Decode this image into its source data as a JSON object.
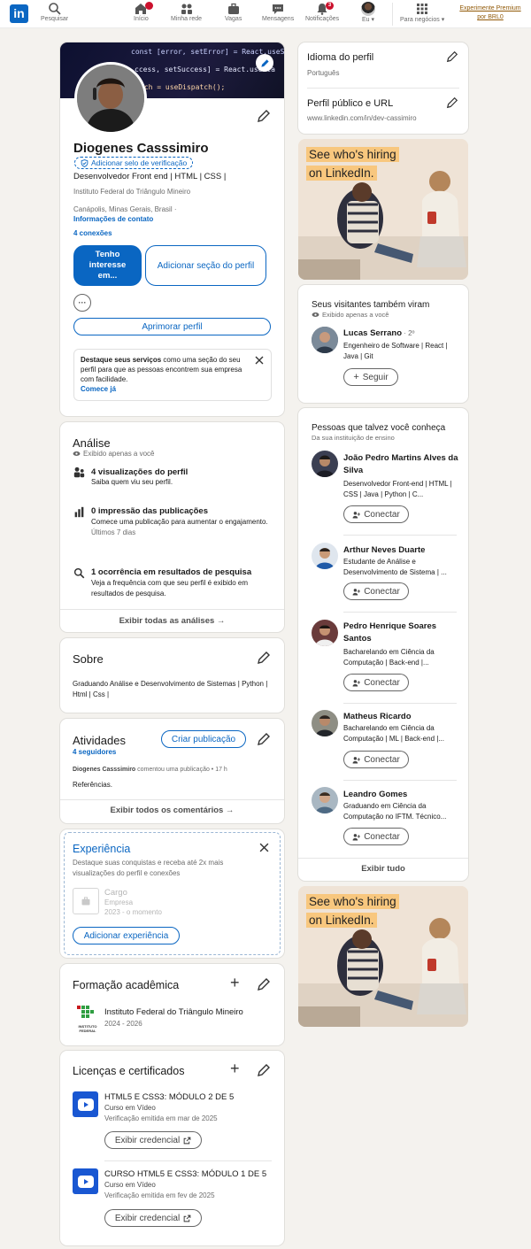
{
  "nav": {
    "search_label": "Pesquisar",
    "items": [
      {
        "label": "Início"
      },
      {
        "label": "Minha rede"
      },
      {
        "label": "Vagas"
      },
      {
        "label": "Mensagens"
      },
      {
        "label": "Notificações",
        "badge": "3"
      },
      {
        "label": "Eu"
      },
      {
        "label": "Para negócios"
      }
    ],
    "premium_line1": "Experimente Premium",
    "premium_line2": "por BRL0"
  },
  "profile": {
    "banner_code_lines": [
      "const [error, setError] = React.useState",
      "ccess, setSuccess] = React.useSta",
      "tch = useDispatch();"
    ],
    "name": "Diogenes Casssimiro",
    "verify_label": "Adicionar selo de verificação",
    "headline": "Desenvolvedor Front end | HTML | CSS |",
    "school": "Instituto Federal do Triângulo Mineiro",
    "location": "Canápolis, Minas Gerais, Brasil ·",
    "contact_link": "Informações de contato",
    "connections": "4 conexões",
    "btn_interest": "Tenho interesse em...",
    "btn_add_section": "Adicionar seção do perfil",
    "btn_more": "···",
    "btn_enhance": "Aprimorar perfil",
    "services_bold": "Destaque seus serviços",
    "services_text": " como uma seção do seu perfil para que as pessoas encontrem sua empresa com facilidade.",
    "services_link": "Comece já"
  },
  "analytics": {
    "title": "Análise",
    "private": "Exibido apenas a você",
    "items": [
      {
        "title": "4 visualizações do perfil",
        "desc": "Saiba quem viu seu perfil.",
        "sub": ""
      },
      {
        "title": "0 impressão das publicações",
        "desc": "Comece uma publicação para aumentar o engajamento.",
        "sub": "Últimos 7 dias"
      },
      {
        "title": "1 ocorrência em resultados de pesquisa",
        "desc": "Veja a frequência com que seu perfil é exibido em resultados de pesquisa.",
        "sub": ""
      }
    ],
    "footer": "Exibir todas as análises →"
  },
  "about": {
    "title": "Sobre",
    "text": "Graduando Análise e Desenvolvimento de Sistemas | Python | Html | Css |"
  },
  "activity": {
    "title": "Atividades",
    "followers": "4 seguidores",
    "create_post": "Criar publicação",
    "author": "Diogenes Casssimiro",
    "action": " comentou uma publicação • 17 h",
    "comment": "Referências.",
    "footer": "Exibir todos os comentários →"
  },
  "experience": {
    "title": "Experiência",
    "desc": "Destaque suas conquistas e receba até 2x mais visualizações do perfil e conexões",
    "role": "Cargo",
    "company": "Empresa",
    "dates": "2023 - o momento",
    "button": "Adicionar experiência"
  },
  "education": {
    "title": "Formação acadêmica",
    "school": "Instituto Federal do Triângulo Mineiro",
    "years": "2024 - 2026",
    "logo_text": "INSTITUTO FEDERAL"
  },
  "licenses": {
    "title": "Licenças e certificados",
    "items": [
      {
        "name": "HTML5 E CSS3: MÓDULO 2 DE 5",
        "issuer": "Curso em Vídeo",
        "date": "Verificação emitida em mar de 2025",
        "button": "Exibir credencial"
      },
      {
        "name": "CURSO HTML5 E CSS3: MÓDULO 1 DE 5",
        "issuer": "Curso em Vídeo",
        "date": "Verificação emitida em fev de 2025",
        "button": "Exibir credencial"
      }
    ]
  },
  "settings": {
    "language_title": "Idioma do perfil",
    "language_value": "Português",
    "public_title": "Perfil público e URL",
    "public_value": "www.linkedin.com/in/dev-cassimiro"
  },
  "ad": {
    "line1": "See who's hiring",
    "line2": "on LinkedIn."
  },
  "visitors": {
    "title": "Seus visitantes também viram",
    "private": "Exibido apenas a você",
    "name": "Lucas Serrano",
    "degree": " · 2º",
    "headline": "Engenheiro de Software | React | Java | Git",
    "button": "Seguir"
  },
  "pymk": {
    "title": "Pessoas que talvez você conheça",
    "subtitle": "Da sua instituição de ensino",
    "people": [
      {
        "name": "João Pedro Martins Alves da Silva",
        "headline": "Desenvolvedor Front-end | HTML | CSS | Java | Python | C..."
      },
      {
        "name": "Arthur Neves Duarte",
        "headline": "Estudante de Análise e Desenvolvimento de Sistema | ..."
      },
      {
        "name": "Pedro Henrique Soares Santos",
        "headline": "Bacharelando em Ciência da Computação | Back-end |..."
      },
      {
        "name": "Matheus Ricardo",
        "headline": "Bacharelando em Ciência da Computação | ML | Back-end |..."
      },
      {
        "name": "Leandro Gomes",
        "headline": "Graduando em Ciência da Computação no IFTM. Técnico..."
      }
    ],
    "connect_label": "Conectar",
    "footer": "Exibir tudo"
  },
  "colors": {
    "primary": "#0a66c2",
    "background": "#f4f2ee",
    "ad_bg": "#efe3d6",
    "ad_highlight": "#f8c77e"
  }
}
